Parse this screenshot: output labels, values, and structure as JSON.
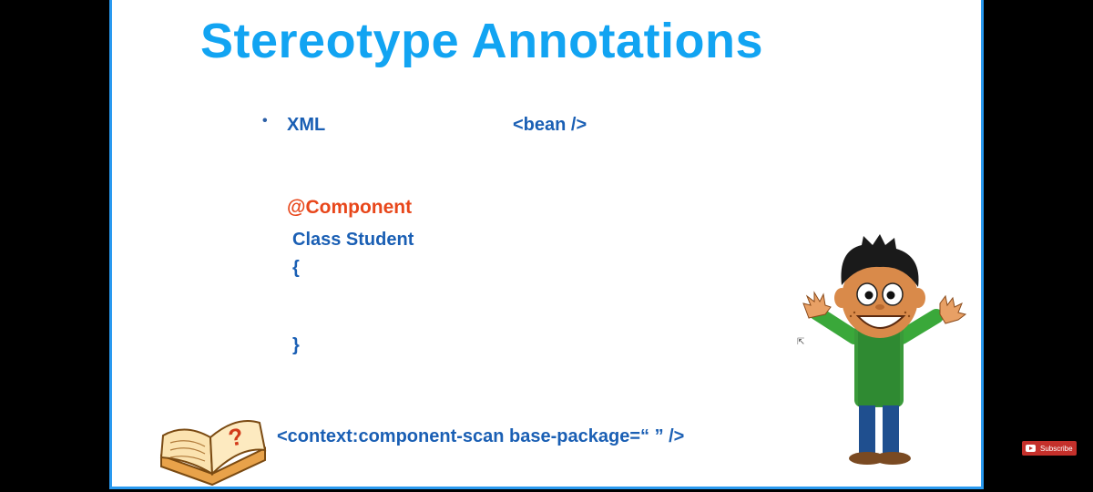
{
  "slide": {
    "title": "Stereotype Annotations",
    "bullet": "•",
    "xml_label": "XML",
    "bean_tag": "<bean />",
    "annotation": "@Component",
    "class_line": "Class Student",
    "open_brace": "{",
    "close_brace": "}",
    "scan_tag": "<context:component-scan base-package=“ ” />"
  },
  "overlay": {
    "subscribe_label": "Subscribe"
  },
  "colors": {
    "title": "#12a4f2",
    "code_blue": "#1a5fb4",
    "annotation_orange": "#e8471b",
    "frame": "#2a9af0",
    "subscribe_bg": "#c4302b"
  },
  "icons": [
    "book-icon",
    "cartoon-boy-illustration",
    "youtube-icon"
  ]
}
